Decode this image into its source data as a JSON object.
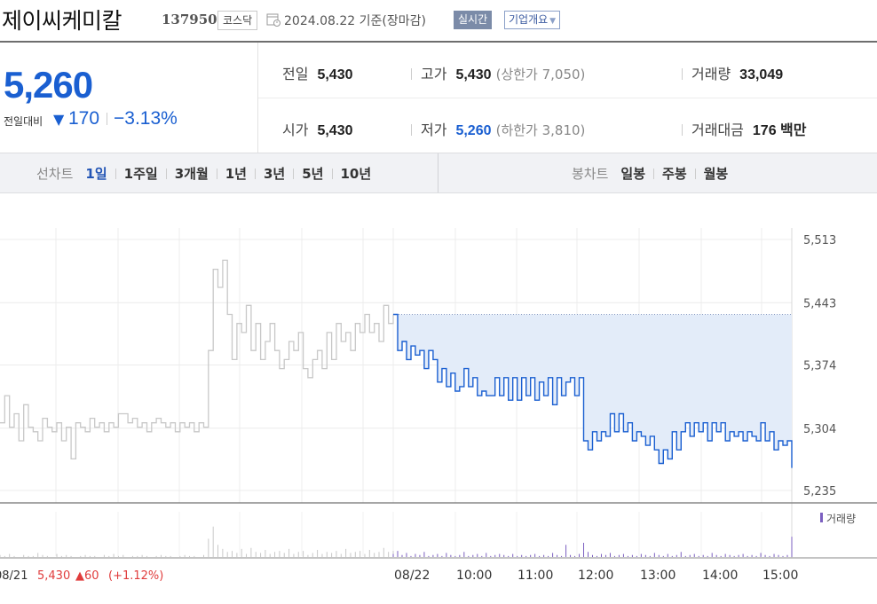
{
  "header": {
    "stock_name": "제이씨케미칼",
    "stock_code": "137950",
    "market": "코스닥",
    "date_text": "2024.08.22  기준(장마감)",
    "realtime_label": "실시간",
    "company_overview_label": "기업개요"
  },
  "price": {
    "current": "5,260",
    "change_label": "전일대비",
    "change_value": "170",
    "change_direction": "down",
    "change_percent": "−3.13%"
  },
  "stats": {
    "prev_close_label": "전일",
    "prev_close": "5,430",
    "high_label": "고가",
    "high": "5,430",
    "upper_limit": "(상한가 7,050)",
    "volume_label": "거래량",
    "volume": "33,049",
    "open_label": "시가",
    "open": "5,430",
    "low_label": "저가",
    "low": "5,260",
    "lower_limit": "(하한가 3,810)",
    "amount_label": "거래대금",
    "amount": "176 백만"
  },
  "tabs": {
    "line_chart_title": "선차트",
    "line_periods": [
      "1일",
      "1주일",
      "3개월",
      "1년",
      "3년",
      "5년",
      "10년"
    ],
    "active_period": "1일",
    "candle_chart_title": "봉차트",
    "candle_periods": [
      "일봉",
      "주봉",
      "월봉"
    ]
  },
  "colors": {
    "accent_blue": "#1a5fd1",
    "prev_day_gray": "#c8c8c8",
    "fill_blue": "#e3ecf9",
    "up_red": "#e03c3c",
    "volume_purple": "#7b5fc0"
  },
  "chart_data": {
    "type": "line",
    "y_ticks": [
      "5,513",
      "5,443",
      "5,374",
      "5,304",
      "5,235"
    ],
    "ylim": [
      5235,
      5513
    ],
    "x_ticks": [
      "08/22",
      "10:00",
      "11:00",
      "12:00",
      "13:00",
      "14:00",
      "15:00"
    ],
    "legend_volume": "거래량",
    "prev_day": {
      "date": "08/21",
      "close": "5,430",
      "change": "▲60",
      "change_percent": "(+1.12%)",
      "values": [
        5310,
        5340,
        5305,
        5320,
        5290,
        5330,
        5305,
        5300,
        5290,
        5315,
        5305,
        5300,
        5310,
        5290,
        5305,
        5270,
        5310,
        5305,
        5300,
        5315,
        5305,
        5310,
        5300,
        5310,
        5305,
        5320,
        5320,
        5310,
        5315,
        5305,
        5310,
        5300,
        5310,
        5315,
        5310,
        5305,
        5310,
        5300,
        5310,
        5305,
        5310,
        5300,
        5310,
        5305,
        5390,
        5480,
        5460,
        5490,
        5430,
        5380,
        5420,
        5410,
        5440,
        5390,
        5420,
        5380,
        5400,
        5420,
        5390,
        5370,
        5380,
        5400,
        5390,
        5410,
        5370,
        5360,
        5380,
        5390,
        5370,
        5410,
        5380,
        5420,
        5400,
        5410,
        5390,
        5420,
        5410,
        5430,
        5410,
        5420,
        5400,
        5440,
        5420,
        5430
      ]
    },
    "today": {
      "values": [
        5430,
        5390,
        5400,
        5380,
        5395,
        5385,
        5390,
        5370,
        5390,
        5380,
        5355,
        5370,
        5350,
        5365,
        5345,
        5350,
        5370,
        5350,
        5360,
        5340,
        5345,
        5340,
        5340,
        5360,
        5340,
        5360,
        5335,
        5360,
        5335,
        5360,
        5340,
        5360,
        5335,
        5355,
        5340,
        5360,
        5330,
        5360,
        5340,
        5355,
        5360,
        5340,
        5360,
        5290,
        5280,
        5300,
        5290,
        5300,
        5295,
        5320,
        5300,
        5320,
        5300,
        5310,
        5290,
        5300,
        5295,
        5285,
        5295,
        5280,
        5265,
        5280,
        5270,
        5300,
        5280,
        5300,
        5310,
        5295,
        5310,
        5300,
        5310,
        5290,
        5310,
        5300,
        5310,
        5290,
        5300,
        5295,
        5300,
        5290,
        5300,
        5295,
        5290,
        5310,
        5290,
        5300,
        5280,
        5290,
        5285,
        5290,
        5260
      ],
      "base": 5430
    },
    "volume_prev": [
      2,
      1,
      3,
      1,
      0,
      2,
      1,
      1,
      4,
      2,
      1,
      0,
      3,
      1,
      2,
      1,
      0,
      1,
      2,
      1,
      1,
      0,
      2,
      1,
      3,
      1,
      2,
      0,
      1,
      1,
      2,
      1,
      0,
      1,
      2,
      1,
      1,
      0,
      1,
      2,
      1,
      1,
      0,
      2,
      18,
      30,
      12,
      8,
      5,
      6,
      4,
      8,
      3,
      9,
      5,
      4,
      7,
      3,
      5,
      6,
      4,
      8,
      3,
      5,
      6,
      2,
      4,
      7,
      3,
      5,
      4,
      6,
      3,
      8,
      4,
      5,
      6,
      3,
      7,
      4,
      5,
      9,
      5,
      6
    ],
    "volume_today": [
      3,
      6,
      2,
      4,
      1,
      3,
      2,
      5,
      1,
      2,
      3,
      1,
      4,
      2,
      1,
      2,
      5,
      1,
      2,
      3,
      1,
      4,
      1,
      2,
      3,
      2,
      1,
      3,
      1,
      2,
      1,
      2,
      3,
      1,
      2,
      1,
      4,
      2,
      1,
      12,
      2,
      1,
      3,
      14,
      5,
      2,
      1,
      3,
      2,
      4,
      1,
      2,
      3,
      1,
      2,
      1,
      3,
      2,
      1,
      4,
      2,
      1,
      3,
      1,
      2,
      5,
      1,
      2,
      3,
      1,
      2,
      1,
      4,
      2,
      1,
      3,
      2,
      1,
      2,
      3,
      1,
      2,
      1,
      4,
      2,
      1,
      3,
      2,
      1,
      2,
      20
    ]
  }
}
